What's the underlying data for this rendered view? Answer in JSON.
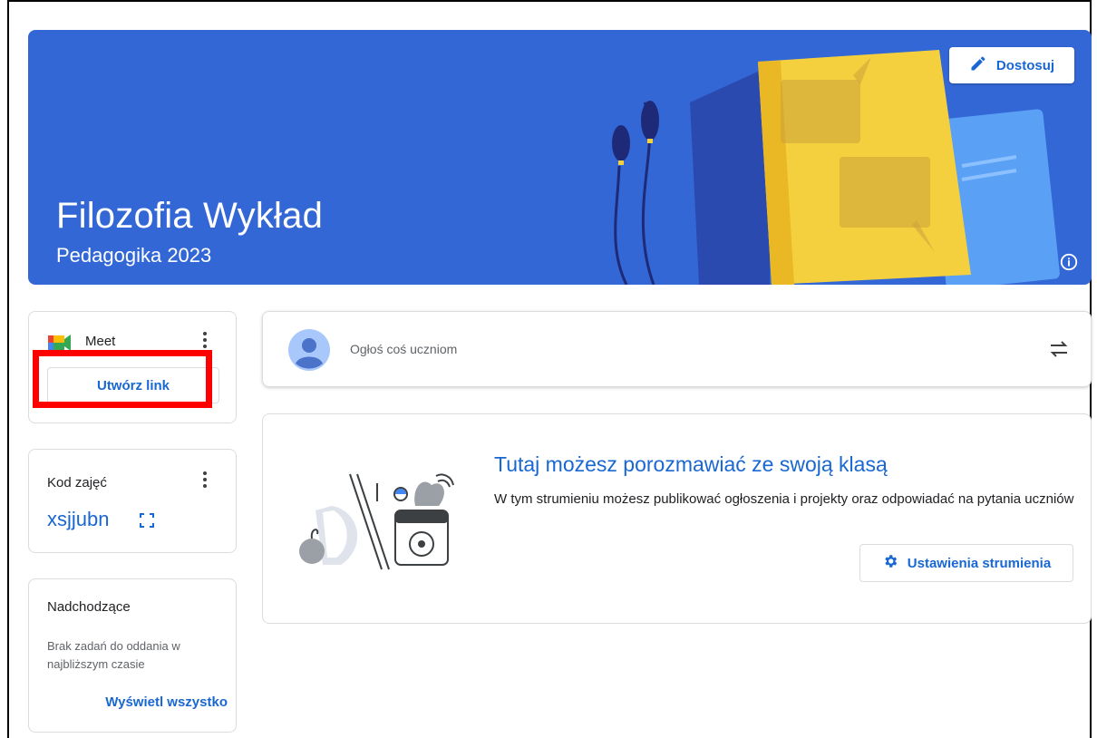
{
  "banner": {
    "title": "Filozofia Wykład",
    "subtitle": "Pedagogika 2023",
    "customize_label": "Dostosuj",
    "background_color": "#3367d6"
  },
  "meet": {
    "title": "Meet",
    "create_link_label": "Utwórz link"
  },
  "class_code": {
    "title": "Kod zajęć",
    "value": "xsjjubn"
  },
  "upcoming": {
    "title": "Nadchodzące",
    "empty_text": "Brak zadań do oddania w najbliższym czasie",
    "view_all_label": "Wyświetl wszystko"
  },
  "announce": {
    "placeholder": "Ogłoś coś uczniom"
  },
  "stream_intro": {
    "title": "Tutaj możesz porozmawiać ze swoją klasą",
    "description": "W tym strumieniu możesz publikować ogłoszenia i projekty oraz odpowiadać na pytania uczniów",
    "settings_label": "Ustawienia strumienia"
  },
  "colors": {
    "accent": "#1967d2",
    "highlight": "#ff0000"
  }
}
